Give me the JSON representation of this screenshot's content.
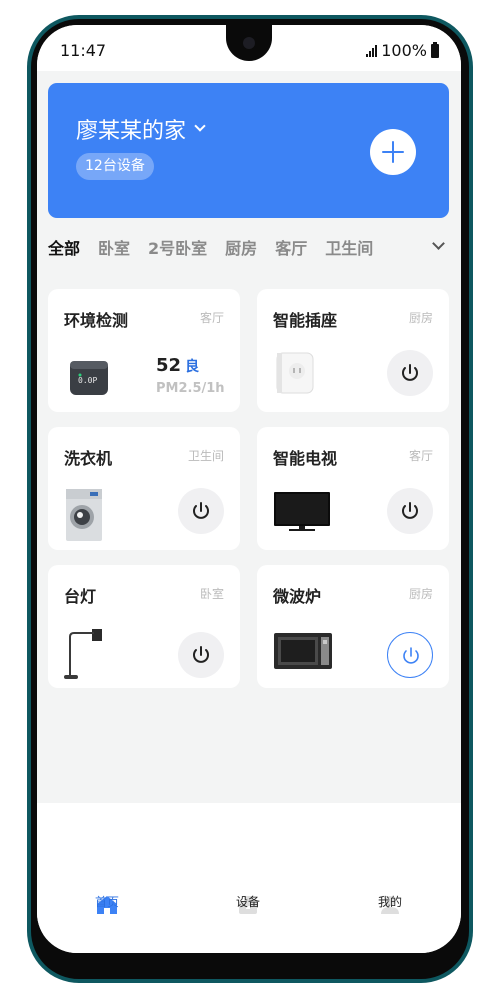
{
  "status_bar": {
    "time": "11:47",
    "battery": "100%"
  },
  "home": {
    "title": "廖某某的家",
    "device_count": "12台设备"
  },
  "tabs": [
    "全部",
    "卧室",
    "2号卧室",
    "厨房",
    "客厅",
    "卫生间"
  ],
  "devices": [
    {
      "name": "环境检测",
      "room": "客厅",
      "value": "52",
      "quality": "良",
      "label": "PM2.5/1h",
      "icon": "air-monitor-image"
    },
    {
      "name": "智能插座",
      "room": "厨房",
      "power": "off",
      "icon": "smart-plug-image"
    },
    {
      "name": "洗衣机",
      "room": "卫生间",
      "power": "off",
      "icon": "washing-machine-image"
    },
    {
      "name": "智能电视",
      "room": "客厅",
      "power": "off",
      "icon": "tv-image"
    },
    {
      "name": "台灯",
      "room": "卧室",
      "power": "off",
      "icon": "desk-lamp-image"
    },
    {
      "name": "微波炉",
      "room": "厨房",
      "power": "on",
      "icon": "microwave-image"
    }
  ],
  "bottom_nav": [
    {
      "label": "首页",
      "icon": "home-icon",
      "active": true
    },
    {
      "label": "设备",
      "icon": "device-icon",
      "active": false
    },
    {
      "label": "我的",
      "icon": "user-icon",
      "active": false
    }
  ],
  "colors": {
    "accent": "#3d82f5",
    "active_text": "#2b6fe0",
    "frame": "#0e5860"
  }
}
